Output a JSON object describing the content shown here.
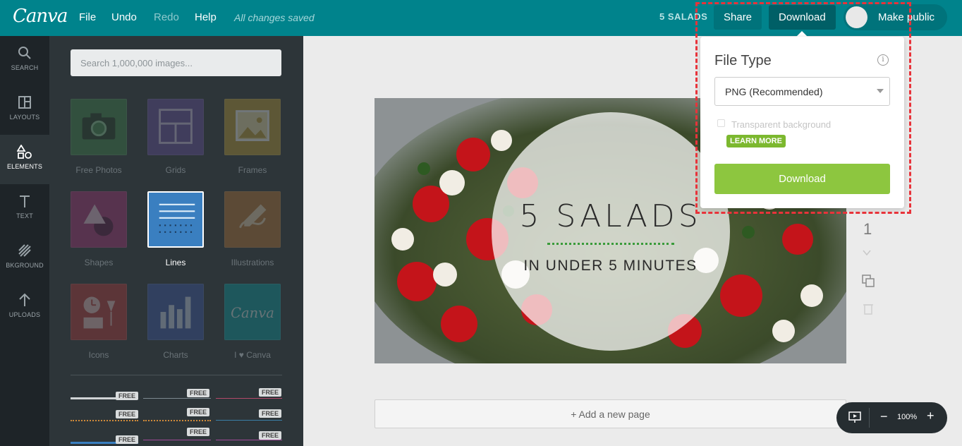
{
  "topbar": {
    "logo": "Canva",
    "menu": [
      "File",
      "Undo",
      "Redo",
      "Help"
    ],
    "saved_status": "All changes saved",
    "doc_title": "5 SALADS",
    "share_label": "Share",
    "download_label": "Download",
    "make_public_label": "Make public"
  },
  "rail": [
    {
      "label": "SEARCH",
      "icon": "search-icon"
    },
    {
      "label": "LAYOUTS",
      "icon": "layouts-icon"
    },
    {
      "label": "ELEMENTS",
      "icon": "elements-icon"
    },
    {
      "label": "TEXT",
      "icon": "text-icon"
    },
    {
      "label": "BKGROUND",
      "icon": "background-icon"
    },
    {
      "label": "UPLOADS",
      "icon": "upload-icon"
    }
  ],
  "panel": {
    "search_placeholder": "Search 1,000,000 images...",
    "tiles": [
      {
        "label": "Free Photos",
        "color": "#3f8a4a"
      },
      {
        "label": "Grids",
        "color": "#6a4fa8"
      },
      {
        "label": "Frames",
        "color": "#c4a030"
      },
      {
        "label": "Shapes",
        "color": "#b0307a"
      },
      {
        "label": "Lines",
        "color": "#3a7fc0"
      },
      {
        "label": "Illustrations",
        "color": "#c07830"
      },
      {
        "label": "Icons",
        "color": "#c03838"
      },
      {
        "label": "Charts",
        "color": "#3a5ab0"
      },
      {
        "label": "I ♥ Canva",
        "color": "#00a0a8"
      }
    ],
    "free_badge": "FREE"
  },
  "canvas": {
    "headline": "5 SALADS",
    "subline": "IN UNDER 5 MINUTES",
    "page_number": "1",
    "add_page": "+ Add a new page"
  },
  "zoom": {
    "value": "100%",
    "minus": "−",
    "plus": "+"
  },
  "download_popup": {
    "title": "File Type",
    "info": "i",
    "file_type": "PNG (Recommended)",
    "transparent_label": "Transparent background",
    "learn_more": "LEARN MORE",
    "download_label": "Download"
  }
}
